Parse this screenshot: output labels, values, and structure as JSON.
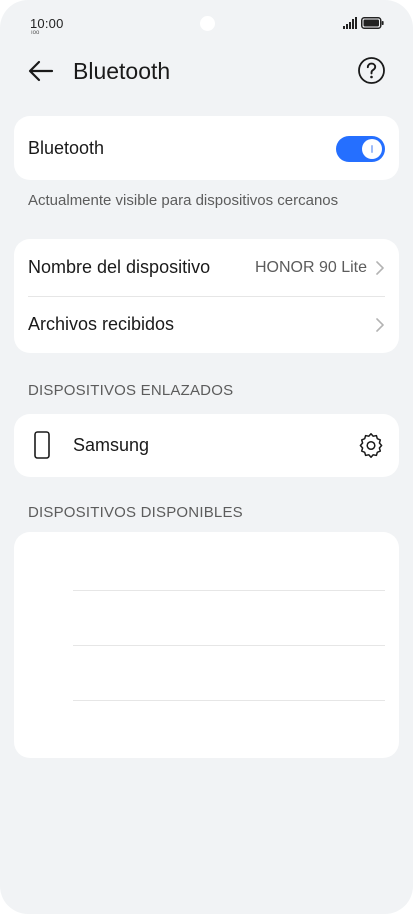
{
  "status_bar": {
    "time": "10:00",
    "sub_text": "ıoo"
  },
  "header": {
    "title": "Bluetooth"
  },
  "bluetooth": {
    "label": "Bluetooth",
    "enabled": true,
    "visibility_caption": "Actualmente visible para dispositivos cercanos"
  },
  "device_settings": {
    "name_label": "Nombre del dispositivo",
    "name_value": "HONOR 90 Lite",
    "received_files_label": "Archivos recibidos"
  },
  "paired_devices": {
    "section_title": "DISPOSITIVOS ENLAZADOS",
    "items": [
      {
        "name": "Samsung",
        "icon": "phone-icon"
      }
    ]
  },
  "available_devices": {
    "section_title": "DISPOSITIVOS DISPONIBLES",
    "items": []
  },
  "colors": {
    "accent": "#256fff",
    "background": "#f1f3f5",
    "card": "#ffffff",
    "secondary_text": "#5c5c5c"
  }
}
